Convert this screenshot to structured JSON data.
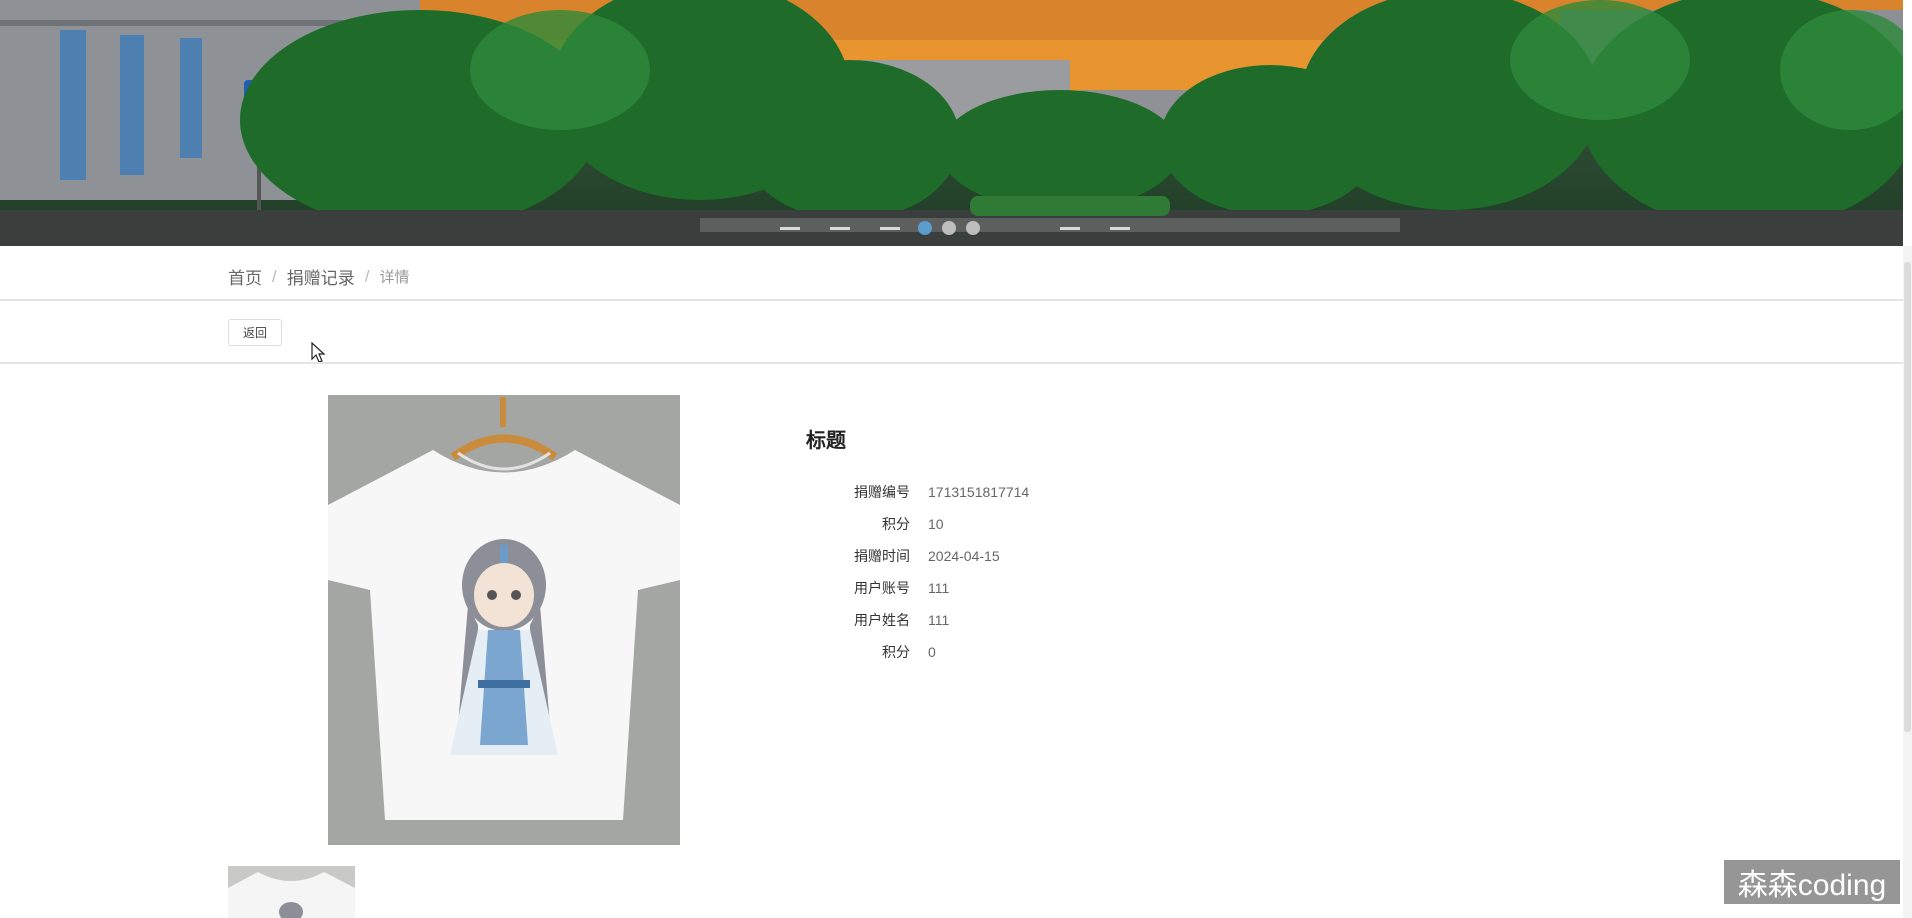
{
  "breadcrumb": {
    "home": "首页",
    "section": "捐赠记录",
    "current": "详情",
    "separator": "/"
  },
  "toolbar": {
    "back_label": "返回"
  },
  "carousel": {
    "slide_count": 3,
    "active_index": 0
  },
  "detail": {
    "title": "标题",
    "fields": [
      {
        "label": "捐赠编号",
        "value": "1713151817714"
      },
      {
        "label": "积分",
        "value": "10"
      },
      {
        "label": "捐赠时间",
        "value": "2024-04-15"
      },
      {
        "label": "用户账号",
        "value": "111"
      },
      {
        "label": "用户姓名",
        "value": "111"
      },
      {
        "label": "积分",
        "value": "0"
      }
    ]
  },
  "watermark": "森森coding",
  "colors": {
    "dot_active": "#5ba4d9",
    "dot_inactive": "#c9c9c9",
    "image_bg": "#a4a6a3"
  }
}
